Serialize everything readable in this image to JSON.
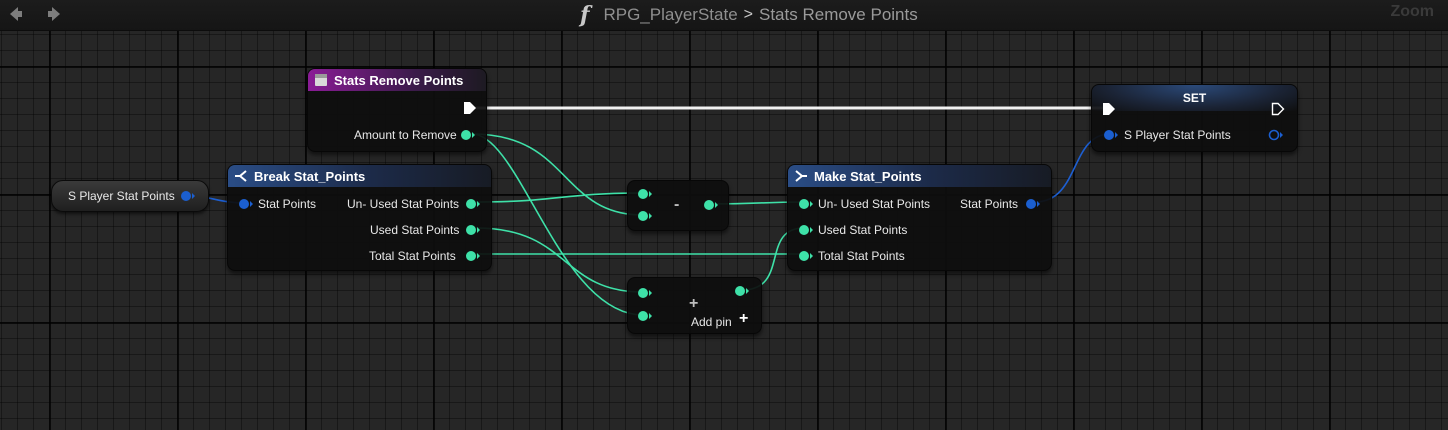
{
  "topbar": {
    "breadcrumb_parent": "RPG_PlayerState",
    "breadcrumb_separator": ">",
    "breadcrumb_current": "Stats Remove Points",
    "zoom_label": "Zoom"
  },
  "colors": {
    "float_pin": "#3ee1a8",
    "struct_pin": "#1b5fd0",
    "exec_pin": "#ffffff",
    "function_header": "#8a1c96",
    "struct_header": "#2a4d86"
  },
  "nodes": {
    "stats_remove_points": {
      "title": "Stats Remove Points",
      "pin_amount": "Amount to Remove"
    },
    "var_get": {
      "label": "S Player Stat Points"
    },
    "break_stat_points": {
      "title": "Break Stat_Points",
      "pin_input": "Stat Points",
      "pin_unused": "Un- Used Stat Points",
      "pin_used": "Used Stat Points",
      "pin_total": "Total Stat Points"
    },
    "subtract": {
      "symbol": "-"
    },
    "add": {
      "symbol": "+",
      "add_pin_label": "Add pin",
      "add_pin_symbol": "+"
    },
    "make_stat_points": {
      "title": "Make Stat_Points",
      "pin_unused": "Un- Used Stat Points",
      "pin_used": "Used Stat Points",
      "pin_total": "Total Stat Points",
      "pin_output": "Stat Points"
    },
    "set": {
      "title": "SET",
      "pin_input": "S Player Stat Points"
    }
  }
}
